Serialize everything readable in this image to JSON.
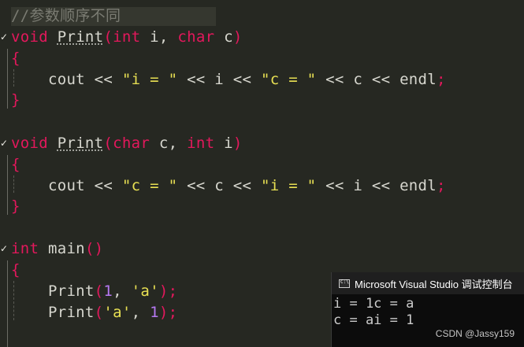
{
  "editor": {
    "comment": "//参数顺序不同",
    "func1": {
      "ret": "void",
      "name": "Print",
      "lparen": "(",
      "t1": "int",
      "p1": " i, ",
      "t2": "char",
      "p2": " c",
      "rparen": ")",
      "open": "{",
      "close": "}",
      "body": {
        "a": "cout << ",
        "s1": "\"i = \"",
        "b": " << i << ",
        "s2": "\"c = \"",
        "c": " << c << endl",
        "semi": ";"
      }
    },
    "func2": {
      "ret": "void",
      "name": "Print",
      "lparen": "(",
      "t1": "char",
      "p1": " c, ",
      "t2": "int",
      "p2": " i",
      "rparen": ")",
      "open": "{",
      "close": "}",
      "body": {
        "a": "cout << ",
        "s1": "\"c = \"",
        "b": " << c << ",
        "s2": "\"i = \"",
        "c": " << i << endl",
        "semi": ";"
      }
    },
    "main": {
      "ret": "int",
      "name": "main",
      "parens": "()",
      "open": "{",
      "call1": {
        "name": "Print",
        "lparen": "(",
        "arg1": "1",
        "sep": ", ",
        "arg2": "'a'",
        "end": ");"
      },
      "call2": {
        "name": "Print",
        "lparen": "(",
        "arg1": "'a'",
        "sep": ", ",
        "arg2": "1",
        "end": ");"
      }
    }
  },
  "console": {
    "title": "Microsoft Visual Studio 调试控制台",
    "icon": "console-icon",
    "output": [
      "i = 1c = a",
      "c = ai = 1"
    ]
  },
  "watermark": "CSDN @Jassy159",
  "colors": {
    "background": "#262822",
    "keyword": "#e3185c",
    "string": "#e8e053",
    "number": "#b679f3",
    "text": "#d7d7cf",
    "comment": "#7a7b72"
  }
}
